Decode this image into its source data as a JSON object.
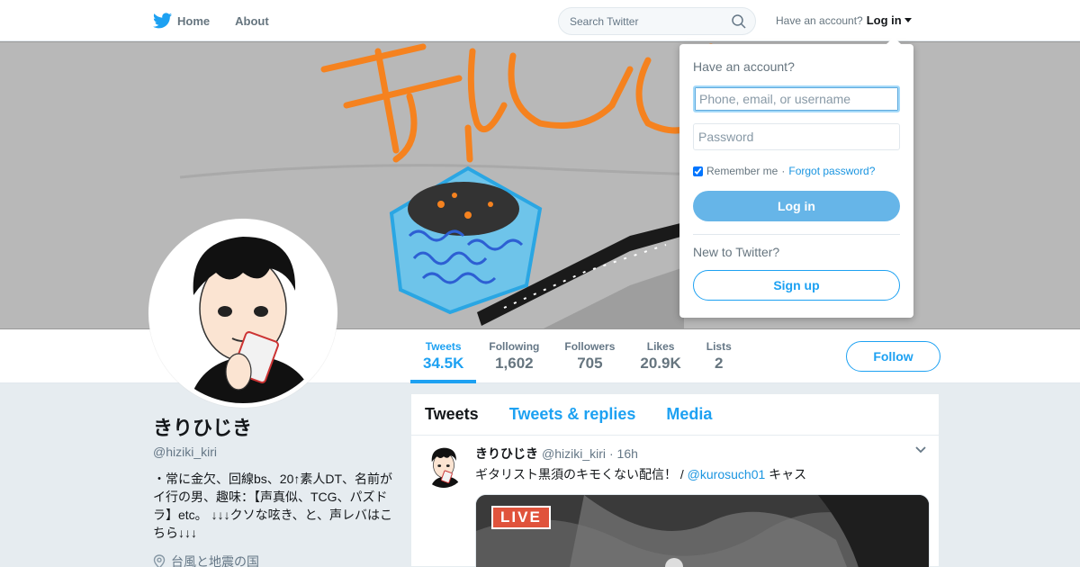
{
  "nav": {
    "home_label": "Home",
    "about_label": "About",
    "search_placeholder": "Search Twitter",
    "have_account": "Have an account?",
    "login_label": "Log in"
  },
  "stats": [
    {
      "label": "Tweets",
      "value": "34.5K"
    },
    {
      "label": "Following",
      "value": "1,602"
    },
    {
      "label": "Followers",
      "value": "705"
    },
    {
      "label": "Likes",
      "value": "20.9K"
    },
    {
      "label": "Lists",
      "value": "2"
    }
  ],
  "follow_label": "Follow",
  "profile": {
    "name": "きりひじき",
    "handle": "@hiziki_kiri",
    "bio": "・常に金欠、回線bs、20↑素人DT、名前がイ行の男、趣味：【声真似、TCG、パズドラ】etc。 ↓↓↓クソな呟き、と、声レバはこちら↓↓↓",
    "location": "台風と地震の国"
  },
  "timeline": {
    "tabs": [
      "Tweets",
      "Tweets & replies",
      "Media"
    ],
    "tweet": {
      "name": "きりひじき",
      "handle": "@hiziki_kiri",
      "time": "· 16h",
      "text_before": "ギタリスト黒須のキモくない配信！ / ",
      "mention": "@kurosuch01",
      "text_after": " キャス",
      "live_badge": "LIVE"
    }
  },
  "login_dropdown": {
    "title": "Have an account?",
    "username_placeholder": "Phone, email, or username",
    "password_placeholder": "Password",
    "remember_label": "Remember me",
    "separator": " · ",
    "forgot_label": "Forgot password?",
    "login_button": "Log in",
    "new_label": "New to Twitter?",
    "signup_button": "Sign up"
  },
  "colors": {
    "accent": "#1da1f2",
    "login_button": "#66b5e8",
    "banner_bg": "#b9b9b9"
  }
}
